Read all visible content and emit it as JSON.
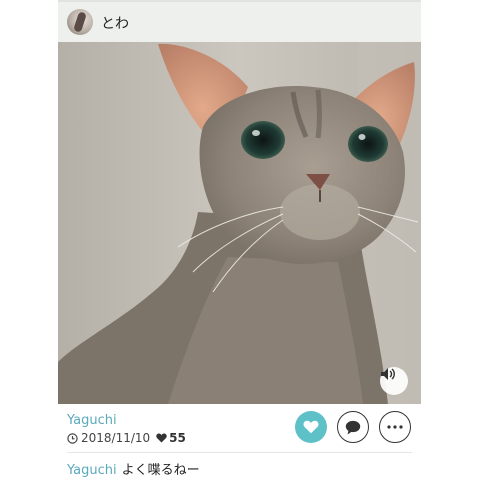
{
  "header": {
    "username": "とわ"
  },
  "photo": {
    "subject": "cat"
  },
  "post": {
    "author": "Yaguchi",
    "date": "2018/11/10",
    "likes": "55"
  },
  "actions": {
    "like_icon": "heart-icon",
    "comment_icon": "speech-bubble-icon",
    "more_icon": "more-dots-icon",
    "sound_icon": "speaker-icon"
  },
  "comment": {
    "user": "Yaguchi",
    "text": "よく喋るねー"
  },
  "colors": {
    "accent": "#5fc1c8",
    "link": "#5aa9ba",
    "header_bg": "#eef0ee"
  }
}
